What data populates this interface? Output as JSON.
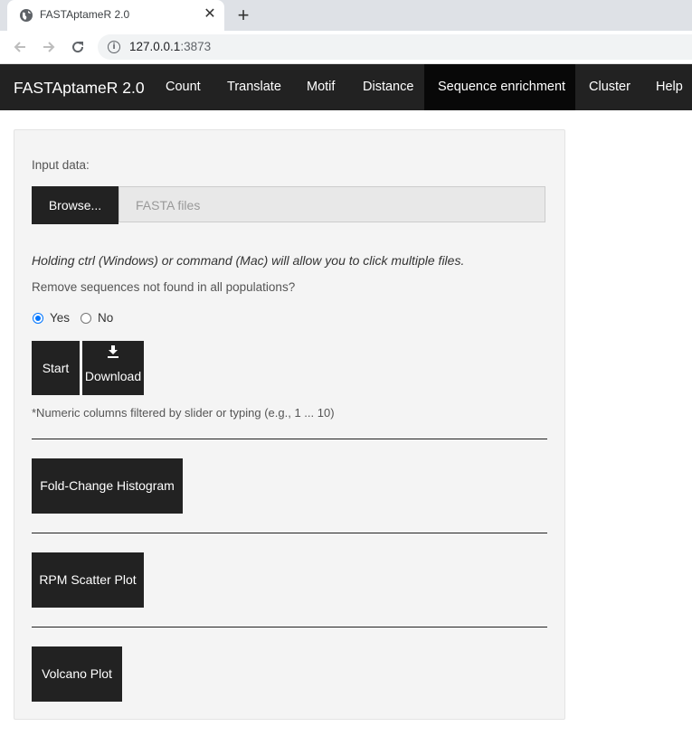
{
  "browser": {
    "tab_title": "FASTAptameR 2.0",
    "close_glyph": "✕",
    "new_tab_glyph": "+",
    "url_host": "127.0.0.1",
    "url_port": ":3873",
    "icons": [
      "globe-icon",
      "back-arrow-icon",
      "forward-arrow-icon",
      "reload-icon",
      "info-icon",
      "close-icon",
      "plus-icon"
    ]
  },
  "navbar": {
    "brand": "FASTAptameR 2.0",
    "items": [
      "Count",
      "Translate",
      "Motif",
      "Distance",
      "Sequence enrichment",
      "Cluster",
      "Help"
    ],
    "active": "Sequence enrichment"
  },
  "panel": {
    "input_label": "Input data:",
    "browse_label": "Browse...",
    "file_placeholder": "FASTA files",
    "hint": "Holding ctrl (Windows) or command (Mac) will allow you to click multiple files.",
    "remove_question": "Remove sequences not found in all populations?",
    "radio_yes": "Yes",
    "radio_no": "No",
    "radio_selected": "Yes",
    "start_label": "Start",
    "download_label": "Download",
    "note": "*Numeric columns filtered by slider or typing (e.g., 1 ... 10)",
    "fold_change_label": "Fold-Change Histogram",
    "rpm_scatter_label": "RPM Scatter Plot",
    "volcano_label": "Volcano Plot"
  },
  "colors": {
    "navbar_bg": "#222222",
    "navbar_active_bg": "#080808",
    "panel_bg": "#f4f4f4",
    "button_bg": "#222222",
    "radio_accent": "#0075ff"
  }
}
